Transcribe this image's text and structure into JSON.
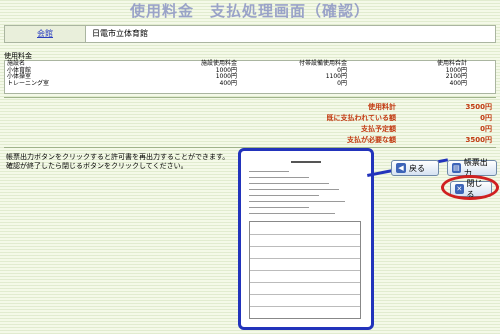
{
  "page": {
    "title": "使用料金　支払処理画面（確認）"
  },
  "facility": {
    "label": "会館",
    "value": "日電市立体育館"
  },
  "fees": {
    "section_label": "使用料金",
    "headers": [
      "施設名",
      "施設使用料金",
      "付帯設備使用料金",
      "使用料合計"
    ],
    "rows": [
      [
        "小体育館",
        "1000円",
        "0円",
        "1000円"
      ],
      [
        "小体操室",
        "1000円",
        "1100円",
        "2100円"
      ],
      [
        "トレーニング室",
        "400円",
        "0円",
        "400円"
      ]
    ]
  },
  "summary": [
    {
      "label": "使用料計",
      "value": "3500円"
    },
    {
      "label": "既に支払われている額",
      "value": "0円"
    },
    {
      "label": "支払予定額",
      "value": "0円"
    },
    {
      "label": "支払が必要な額",
      "value": "3500円"
    }
  ],
  "message": {
    "line1": "帳票出力ボタンをクリックすると許可書を再出力することができます。",
    "line2": "確認が終了したら閉じるボタンをクリックしてください。"
  },
  "buttons": {
    "back": "戻る",
    "print": "帳票出力",
    "close": "閉じる"
  },
  "colors": {
    "title": "#9aa3c8",
    "summary": "#c23a12",
    "highlight": "#d02020",
    "callout": "#2233bb"
  },
  "icons": {
    "back": "arrow-left-icon",
    "print": "printer-icon",
    "close": "close-icon"
  }
}
